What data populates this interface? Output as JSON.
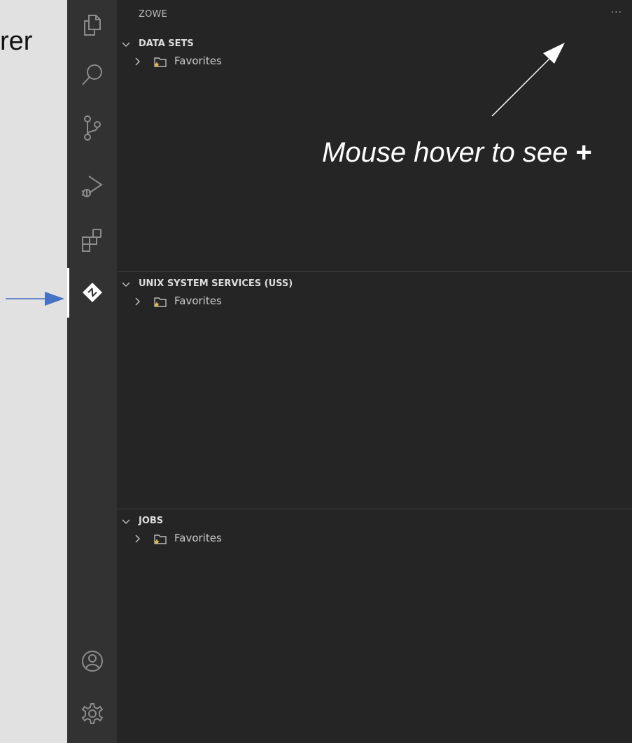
{
  "left_panel": {
    "text": "rer"
  },
  "activity_bar": {
    "items": [
      {
        "name": "explorer-icon"
      },
      {
        "name": "search-icon"
      },
      {
        "name": "source-control-icon"
      },
      {
        "name": "run-debug-icon"
      },
      {
        "name": "extensions-icon"
      },
      {
        "name": "zowe-icon",
        "active": true
      }
    ],
    "bottom": [
      {
        "name": "account-icon"
      },
      {
        "name": "settings-gear-icon"
      }
    ]
  },
  "sidebar": {
    "title": "ZOWE",
    "more_actions": "···",
    "sections": [
      {
        "title": "DATA SETS",
        "items": [
          {
            "label": "Favorites"
          }
        ]
      },
      {
        "title": "UNIX SYSTEM SERVICES (USS)",
        "items": [
          {
            "label": "Favorites"
          }
        ]
      },
      {
        "title": "JOBS",
        "items": [
          {
            "label": "Favorites"
          }
        ]
      }
    ]
  },
  "annotation": {
    "text": "Mouse hover to see",
    "symbol": "+"
  },
  "colors": {
    "activity_bar": "#323232",
    "sidebar": "#252526",
    "arrow": "#4472c4"
  }
}
